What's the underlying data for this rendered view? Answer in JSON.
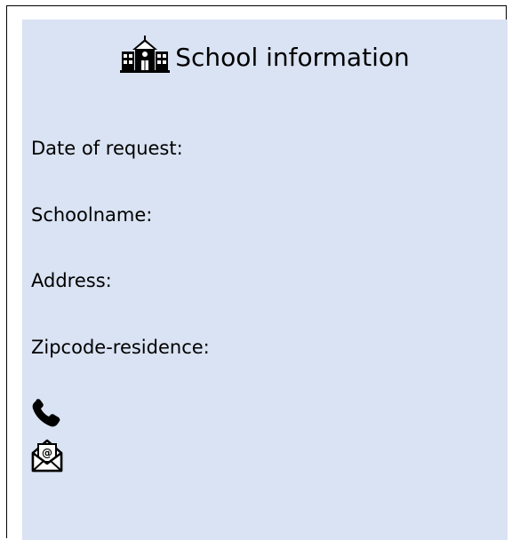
{
  "title": "School information",
  "fields": {
    "date_of_request": "Date of request:",
    "schoolname": "Schoolname:",
    "address": "Address:",
    "zipcode_residence": "Zipcode-residence:"
  },
  "icons": {
    "title": "school-building-icon",
    "phone": "phone-icon",
    "email": "email-icon"
  },
  "colors": {
    "panel_background": "#dae3f3",
    "border": "#000000",
    "text": "#000000"
  }
}
